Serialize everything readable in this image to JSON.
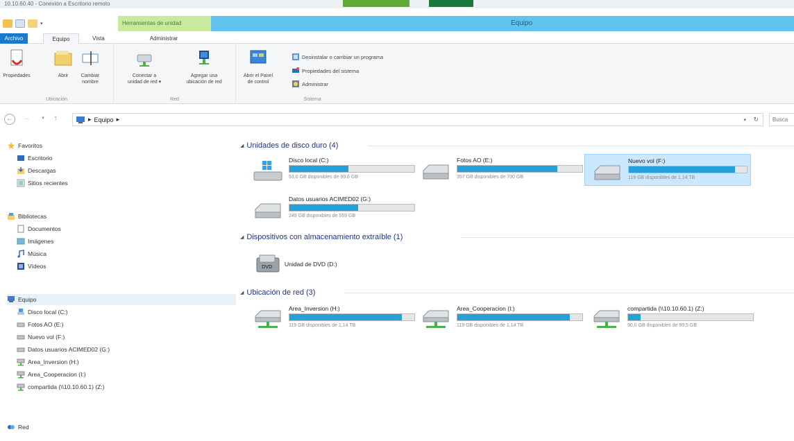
{
  "rdp": {
    "title": "10.10.60.40 - Conexión a Escritorio remoto"
  },
  "window": {
    "title": "Equipo",
    "context_tab": "Herramientas de unidad"
  },
  "ribbon_tabs": {
    "file": "Archivo",
    "equipo": "Equipo",
    "vista": "Vista",
    "administrar": "Administrar"
  },
  "ribbon": {
    "ubicacion": {
      "label": "Ubicación",
      "propiedades": "Propiedades",
      "abrir": "Abrir",
      "cambiar_nombre": "Cambiar\nnombre"
    },
    "red": {
      "label": "Red",
      "conectar_unidad": "Conectar a\nunidad de red ▾",
      "agregar_ubicacion": "Agregar una\nubicación de red"
    },
    "sistema": {
      "label": "Sistema",
      "abrir_panel": "Abrir el Panel\nde control",
      "desinstalar": "Desinstalar o cambiar un programa",
      "propiedades_sistema": "Propiedades del sistema",
      "administrar": "Administrar"
    }
  },
  "address": {
    "path": "Equipo",
    "search_placeholder": "Busca"
  },
  "sidebar": {
    "favoritos": "Favoritos",
    "escritorio": "Escritorio",
    "descargas": "Descargas",
    "sitios_recientes": "Sitios recientes",
    "bibliotecas": "Bibliotecas",
    "documentos": "Documentos",
    "imagenes": "Imágenes",
    "musica": "Música",
    "videos": "Vídeos",
    "equipo": "Equipo",
    "disco_local": "Disco local (C:)",
    "fotos_ao": "Fotos AO (E:)",
    "nuevo_vol": "Nuevo vol (F:)",
    "datos_usuarios": "Datos usuarios ACIMED02 (G:)",
    "area_inversion": "Area_Inversion (H:)",
    "area_cooperacion": "Area_Cooperacion (I:)",
    "compartida": "compartida (\\\\10.10.60.1) (Z:)",
    "red": "Red"
  },
  "sections": {
    "hdd": "Unidades de disco duro (4)",
    "removable": "Dispositivos con almacenamiento extraíble (1)",
    "network": "Ubicación de red (3)"
  },
  "drives": [
    {
      "name": "Disco local (C:)",
      "free": "53,0 GB disponibles de 99,6 GB",
      "used_fraction": 0.47,
      "icon": "windows-drive-icon"
    },
    {
      "name": "Fotos AO (E:)",
      "free": "357 GB disponibles de 700 GB",
      "used_fraction": 0.8,
      "icon": "hard-drive-icon"
    },
    {
      "name": "Nuevo vol (F:)",
      "free": "119 GB disponibles de 1,14 TB",
      "used_fraction": 0.9,
      "icon": "hard-drive-icon"
    },
    {
      "name": "Datos usuarios ACIMED02 (G:)",
      "free": "249 GB disponibles de 559 GB",
      "used_fraction": 0.55,
      "icon": "hard-drive-icon"
    }
  ],
  "dvd": {
    "name": "Unidad de DVD (D:)",
    "icon": "dvd-drive-icon"
  },
  "network_drives": [
    {
      "name": "Area_Inversion (H:)",
      "free": "119 GB disponibles de 1,14 TB",
      "used_fraction": 0.9,
      "icon": "network-drive-icon"
    },
    {
      "name": "Area_Cooperacion (I:)",
      "free": "119 GB disponibles de 1,14 TB",
      "used_fraction": 0.9,
      "icon": "network-drive-icon"
    },
    {
      "name": "compartida (\\\\10.10.60.1) (Z:)",
      "free": "90,0 GB disponibles de 99,5 GB",
      "used_fraction": 0.1,
      "icon": "network-drive-icon"
    }
  ],
  "colors": {
    "bar_fill": "#26a0da",
    "title_band": "#61c4ef",
    "context_tab": "#c9ea9c",
    "section_header": "#1e3287"
  }
}
